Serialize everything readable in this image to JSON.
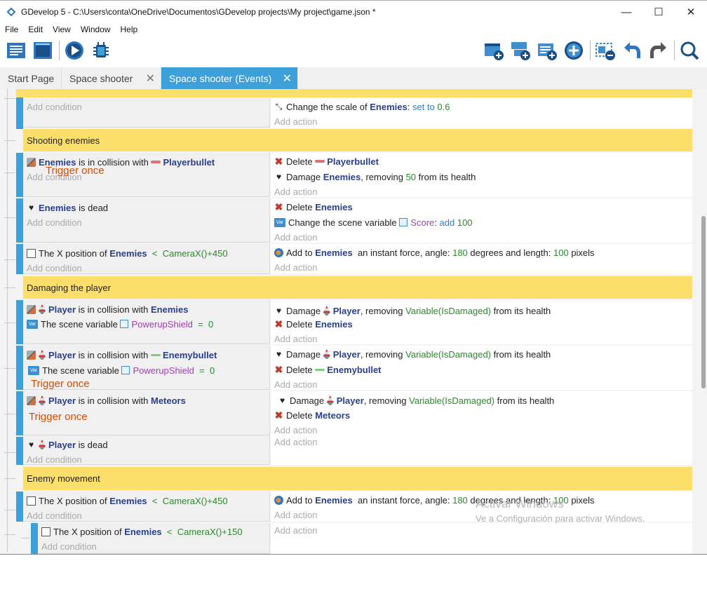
{
  "window": {
    "title": "GDevelop 5 - C:\\Users\\conta\\OneDrive\\Documentos\\GDevelop projects\\My project\\game.json *",
    "minimize": "—",
    "maximize": "☐",
    "close": "✕"
  },
  "menu": [
    "File",
    "Edit",
    "View",
    "Window",
    "Help"
  ],
  "toolbar": {
    "left": [
      "project-manager-icon",
      "scene-editor-icon",
      "preview-icon",
      "debugger-icon"
    ],
    "right": [
      "add-event-icon",
      "add-subevent-icon",
      "add-comment-icon",
      "add-other-icon",
      "delete-event-icon",
      "undo-icon",
      "redo-icon",
      "search-icon"
    ]
  },
  "tabs": [
    {
      "label": "Start Page"
    },
    {
      "label": "Space shooter",
      "close": "✕"
    },
    {
      "label": "Space shooter (Events)",
      "close": "✕"
    }
  ],
  "placeholders": {
    "add_condition": "Add condition",
    "add_action": "Add action"
  },
  "events": {
    "e0": {
      "a1": {
        "pre": "Change the scale of",
        "obj": "Enemies",
        "sep": ":",
        "op": "set to",
        "val": "0.6"
      }
    },
    "c1": {
      "text": "Shooting enemies"
    },
    "e1": {
      "c1": {
        "obj": "Enemies",
        "mid": "is in collision with",
        "obj2": "Playerbullet"
      },
      "a1": {
        "pre": "Delete",
        "obj": "Playerbullet"
      },
      "a2": {
        "pre": "Damage",
        "obj": "Enemies",
        "mid": ", removing",
        "val": "50",
        "post": "from its health"
      }
    },
    "e2": {
      "c1": {
        "obj": "Enemies",
        "mid": "is dead"
      },
      "a1": {
        "pre": "Delete",
        "obj": "Enemies"
      },
      "a2": {
        "pre": "Change the scene variable",
        "var": "Score",
        "sep": ":",
        "op": "add",
        "val": "100"
      }
    },
    "e3": {
      "c1": {
        "pre": "The X position of",
        "obj": "Enemies",
        "op": "<",
        "val": "CameraX()+450"
      },
      "a1": {
        "pre": "Add to",
        "obj": "Enemies",
        "mid": "an instant force, angle:",
        "val": "180",
        "mid2": "degrees and length:",
        "val2": "100",
        "post": "pixels"
      }
    },
    "c2": {
      "text": "Damaging the player"
    },
    "e4": {
      "c1": {
        "obj": "Player",
        "mid": "is in collision with",
        "obj2": "Enemies"
      },
      "c2": {
        "pre": "The scene variable",
        "var": "PowerupShield",
        "op": "=",
        "val": "0"
      },
      "a1": {
        "pre": "Damage",
        "obj": "Player",
        "mid": ", removing",
        "val": "Variable(IsDamaged)",
        "post": "from its health"
      },
      "a2": {
        "pre": "Delete",
        "obj": "Enemies"
      }
    },
    "e5": {
      "c1": {
        "obj": "Player",
        "mid": "is in collision with",
        "obj2": "Enemybullet"
      },
      "c2": {
        "pre": "The scene variable",
        "var": "PowerupShield",
        "op": "=",
        "val": "0"
      },
      "a1": {
        "pre": "Damage",
        "obj": "Player",
        "mid": ", removing",
        "val": "Variable(IsDamaged)",
        "post": "from its health"
      },
      "a2": {
        "pre": "Delete",
        "obj": "Enemybullet"
      }
    },
    "e6": {
      "c1": {
        "obj": "Player",
        "mid": "is in collision with",
        "obj2": "Meteors"
      },
      "a1": {
        "pre": "Damage",
        "obj": "Player",
        "mid": ", removing",
        "val": "Variable(IsDamaged)",
        "post": "from its health"
      },
      "a2": {
        "pre": "Delete",
        "obj": "Meteors"
      }
    },
    "e7": {
      "c1": {
        "obj": "Player",
        "mid": "is dead"
      }
    },
    "c3": {
      "text": "Enemy movement"
    },
    "e8": {
      "c1": {
        "pre": "The X position of",
        "obj": "Enemies",
        "op": "<",
        "val": "CameraX()+450"
      },
      "a1": {
        "pre": "Add to",
        "obj": "Enemies",
        "mid": "an instant force, angle:",
        "val": "180",
        "mid2": "degrees and length:",
        "val2": "100",
        "post": "pixels"
      }
    },
    "e9": {
      "c1": {
        "pre": "The X position of",
        "obj": "Enemies",
        "op": "<",
        "val": "CameraX()+150"
      }
    }
  },
  "overlay": {
    "trigger_once": "Trigger once"
  },
  "watermark": {
    "title": "Activar Windows",
    "subtitle": "Ve a Configuración para activar Windows."
  }
}
